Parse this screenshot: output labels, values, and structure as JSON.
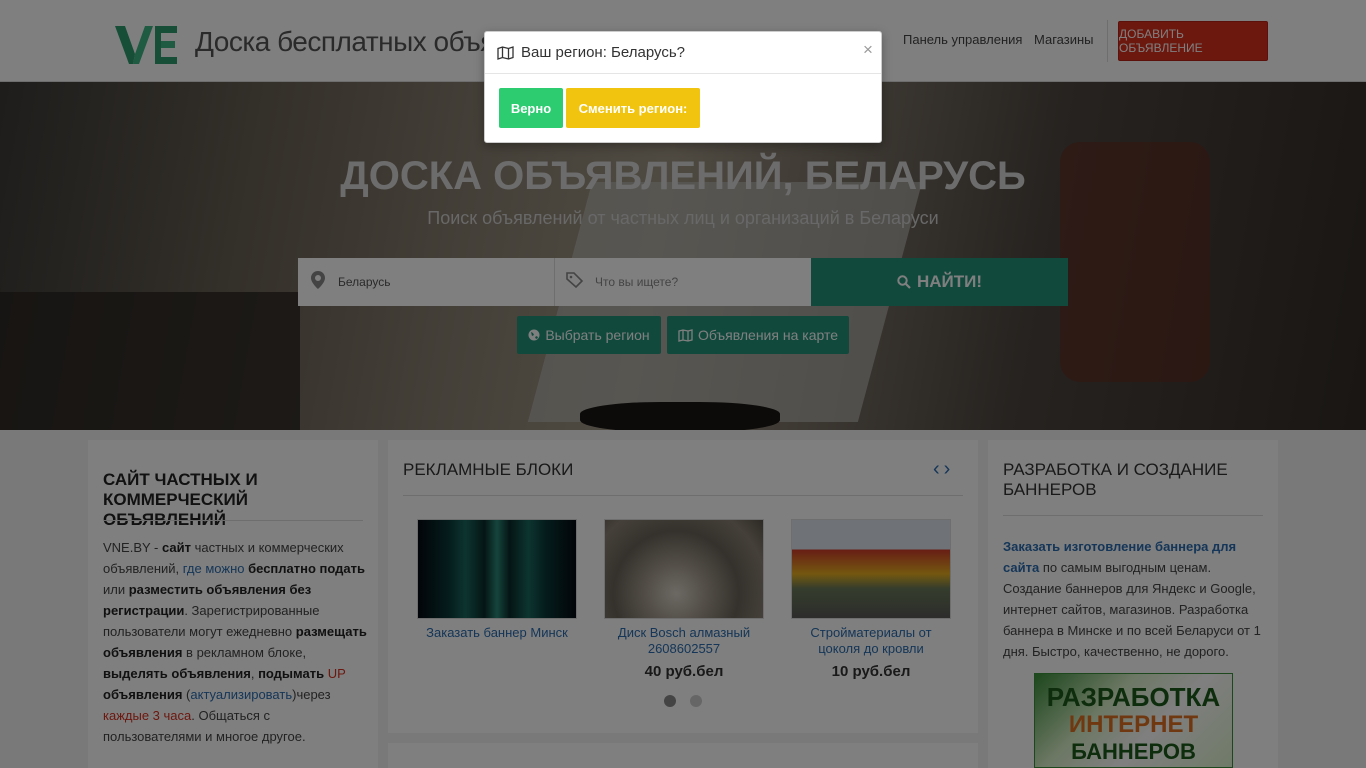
{
  "header": {
    "logo_text": "VNE",
    "site_title": "Доска бесплатных объявлений",
    "nav": [
      "Панель управления",
      "Магазины"
    ],
    "add_button": "ДОБАВИТЬ ОБЪЯВЛЕНИЕ"
  },
  "hero": {
    "title": "ДОСКА ОБЪЯВЛЕНИЙ, БЕЛАРУСЬ",
    "subtitle": "Поиск объявлений от частных лиц и организаций в Беларуси",
    "location_value": "Беларусь",
    "query_placeholder": "Что вы ищете?",
    "search_button": "НАЙТИ!",
    "region_button": "Выбрать регион",
    "map_button": "Объявления на карте"
  },
  "left_card": {
    "title": "САЙТ ЧАСТНЫХ И КОММЕРЧЕСКИЙ ОБЪЯВЛЕНИЙ",
    "p": [
      "VNE.BY - ",
      "сайт",
      " частных и коммерческих объявлений, ",
      "где можно",
      " ",
      "бесплатно подать",
      " или ",
      "разместить объявления без регистрации",
      ". Зарегистрированные пользователи  могут ежедневно ",
      "размещать объявления",
      " в рекламном блоке, ",
      "выделять объявления",
      ", ",
      "подымать",
      " ",
      "UP",
      " ",
      "объявления",
      " (",
      "актуализировать",
      ")через ",
      "каждые 3 часа",
      ". Общаться с пользователями и многое другое."
    ]
  },
  "mid_card": {
    "title": "РЕКЛАМНЫЕ БЛОКИ",
    "items": [
      {
        "name": "Заказать баннер Минск",
        "price": ""
      },
      {
        "name": "Диск Bosch алмазный 2608602557",
        "price": "40 руб.бел"
      },
      {
        "name": "Стройматериалы от цоколя до кровли",
        "price": "10 руб.бел"
      }
    ]
  },
  "right_card": {
    "title": "РАЗРАБОТКА И СОЗДАНИЕ БАННЕРОВ",
    "link": "Заказать изготовление баннера для сайта",
    "text": " по самым выгодным ценам. Создание баннеров для Яндекс и Google, интернет сайтов, магазинов. Разработка баннера в Минске и по всей Беларуси от 1 дня. Быстро, качественно, не дорого.",
    "banner": [
      "РАЗРАБОТКА",
      "ИНТЕРНЕТ",
      "БАННЕРОВ"
    ]
  },
  "modal": {
    "title": "Ваш регион: Беларусь?",
    "close": "×",
    "confirm": "Верно",
    "change": "Сменить регион:"
  },
  "colors": {
    "accent_green": "#23947a",
    "confirm_green": "#2ecc71",
    "change_yellow": "#f1c40f",
    "add_red": "#d9301e"
  }
}
